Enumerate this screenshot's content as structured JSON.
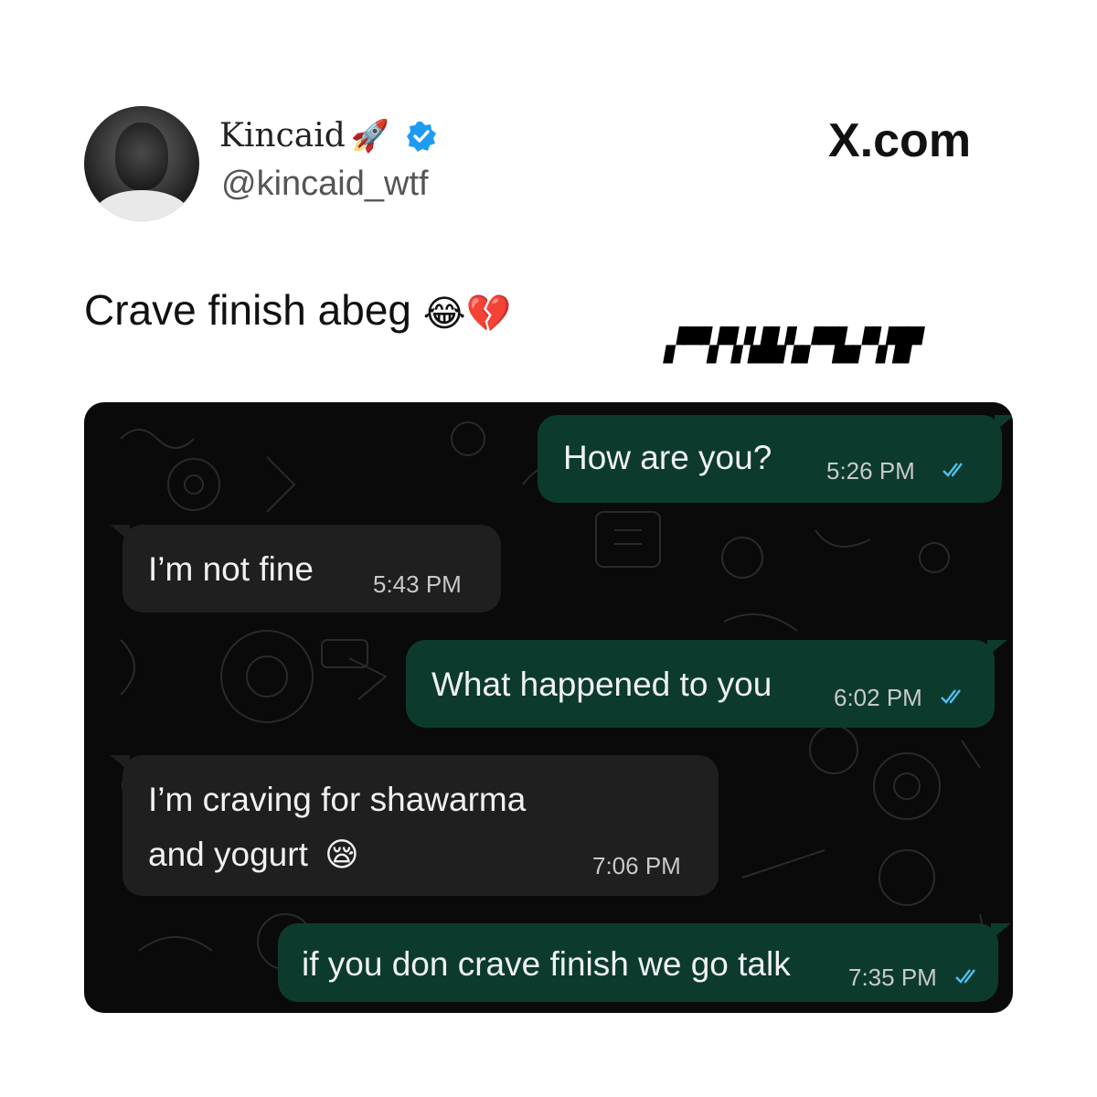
{
  "post": {
    "author_name": "Kincaid",
    "author_emoji": "🚀",
    "handle": "@kincaid_wtf",
    "site": "X.com",
    "text": "Crave finish abeg",
    "text_emojis": "😂💔",
    "verified_color": "#1d9bf0"
  },
  "chat": {
    "messages": [
      {
        "direction": "outgoing",
        "text": "How are you?",
        "time": "5:26 PM",
        "read": true
      },
      {
        "direction": "incoming",
        "text": "I’m not fine",
        "time": "5:43 PM"
      },
      {
        "direction": "outgoing",
        "text": "What happened to you",
        "time": "6:02 PM",
        "read": true
      },
      {
        "direction": "incoming",
        "text_line1": "I’m craving for shawarma",
        "text_line2": "and yogurt",
        "emoji": "😪",
        "time": "7:06 PM"
      },
      {
        "direction": "outgoing",
        "text": "if you don crave finish we go talk",
        "time": "7:35 PM",
        "read": true
      }
    ],
    "outgoing_color": "#0c3b2e",
    "incoming_color": "#1f1f1f",
    "tick_color": "#53bdeb"
  }
}
